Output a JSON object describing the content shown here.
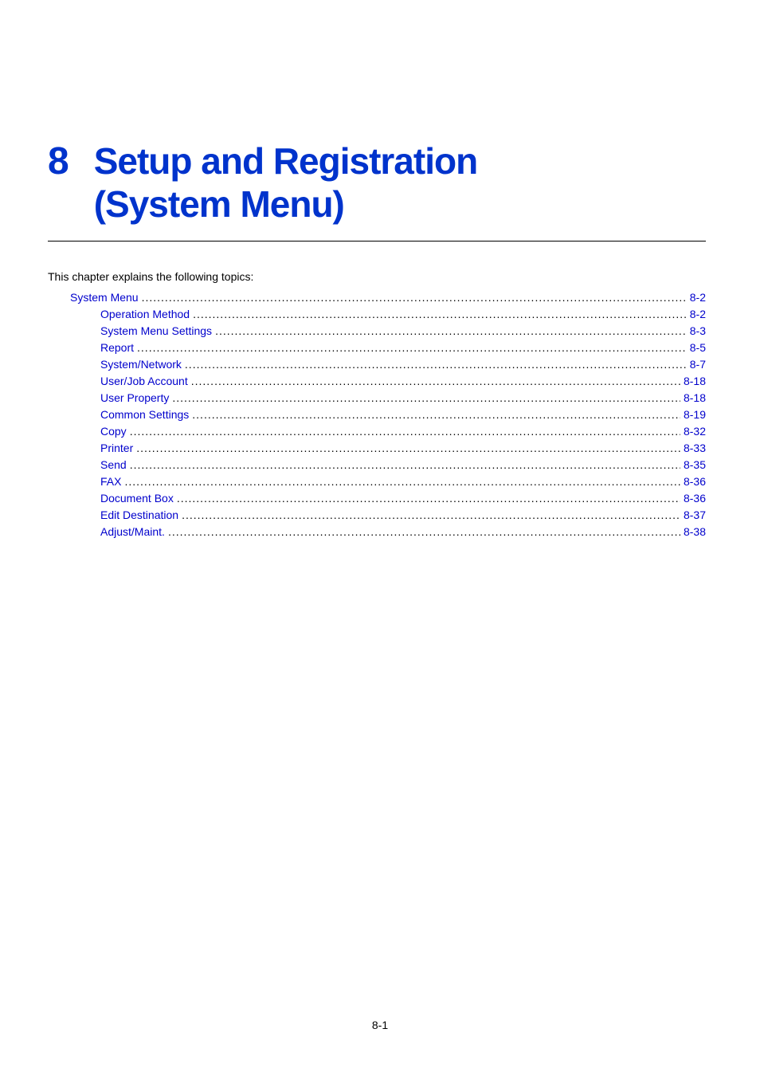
{
  "chapter": {
    "number": "8",
    "title_line1": "Setup and Registration",
    "title_line2": "(System Menu)"
  },
  "intro_text": "This chapter explains the following topics:",
  "toc": [
    {
      "level": 0,
      "label": "System Menu",
      "page": "8-2"
    },
    {
      "level": 1,
      "label": "Operation Method",
      "page": "8-2"
    },
    {
      "level": 1,
      "label": "System Menu Settings",
      "page": "8-3"
    },
    {
      "level": 1,
      "label": "Report",
      "page": "8-5"
    },
    {
      "level": 1,
      "label": "System/Network",
      "page": "8-7"
    },
    {
      "level": 1,
      "label": "User/Job Account",
      "page": "8-18"
    },
    {
      "level": 1,
      "label": "User Property",
      "page": "8-18"
    },
    {
      "level": 1,
      "label": "Common Settings",
      "page": "8-19"
    },
    {
      "level": 1,
      "label": "Copy",
      "page": "8-32"
    },
    {
      "level": 1,
      "label": "Printer",
      "page": "8-33"
    },
    {
      "level": 1,
      "label": "Send",
      "page": "8-35"
    },
    {
      "level": 1,
      "label": "FAX",
      "page": "8-36"
    },
    {
      "level": 1,
      "label": "Document Box",
      "page": "8-36"
    },
    {
      "level": 1,
      "label": "Edit Destination",
      "page": "8-37"
    },
    {
      "level": 1,
      "label": "Adjust/Maint.",
      "page": "8-38"
    }
  ],
  "footer_page": "8-1"
}
